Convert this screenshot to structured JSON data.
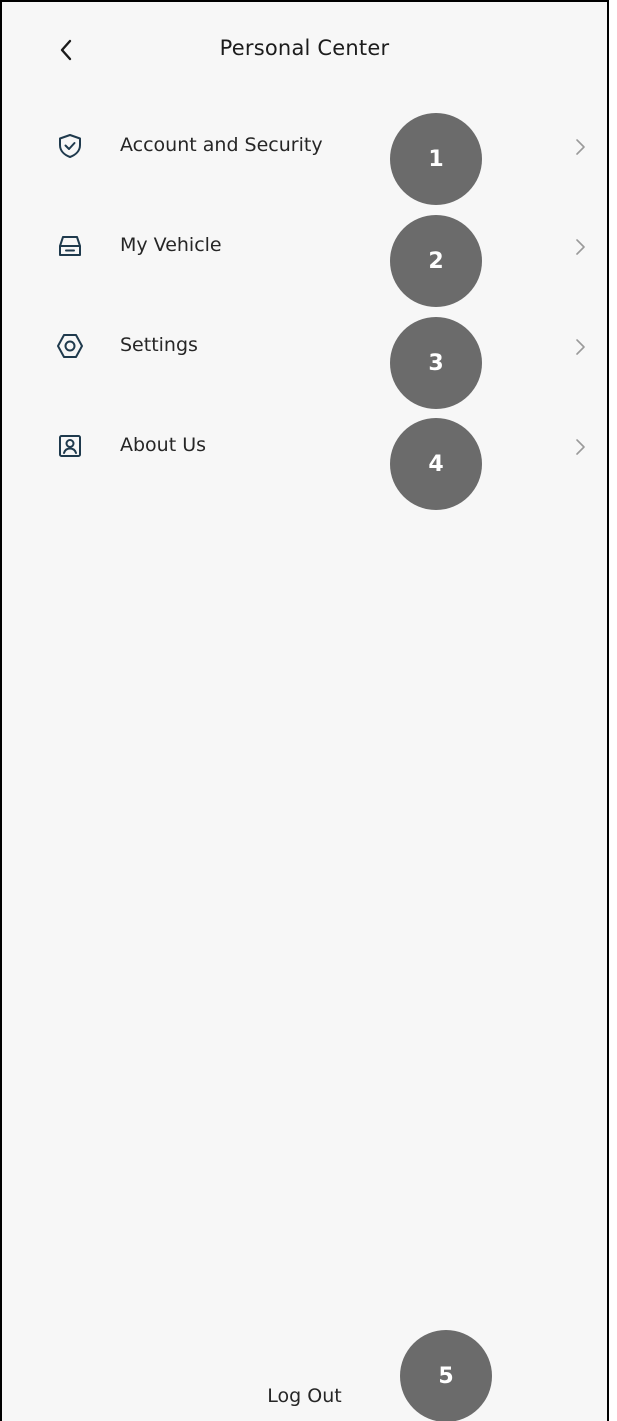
{
  "header": {
    "back_icon": "chevron-left-icon",
    "title": "Personal Center"
  },
  "menu": {
    "items": [
      {
        "label": "Account and Security",
        "icon": "shield-check-icon",
        "chevron_icon": "chevron-right-icon"
      },
      {
        "label": "My Vehicle",
        "icon": "car-icon",
        "chevron_icon": "chevron-right-icon"
      },
      {
        "label": "Settings",
        "icon": "hexagon-gear-icon",
        "chevron_icon": "chevron-right-icon"
      },
      {
        "label": "About Us",
        "icon": "user-card-icon",
        "chevron_icon": "chevron-right-icon"
      }
    ]
  },
  "footer": {
    "logout_label": "Log Out"
  },
  "annotations": {
    "badges": [
      "1",
      "2",
      "3",
      "4",
      "5"
    ]
  },
  "colors": {
    "background": "#f7f7f7",
    "icon_stroke": "#1f3a4d",
    "chevron": "#9a9a9a",
    "badge": "#6b6b6b"
  }
}
